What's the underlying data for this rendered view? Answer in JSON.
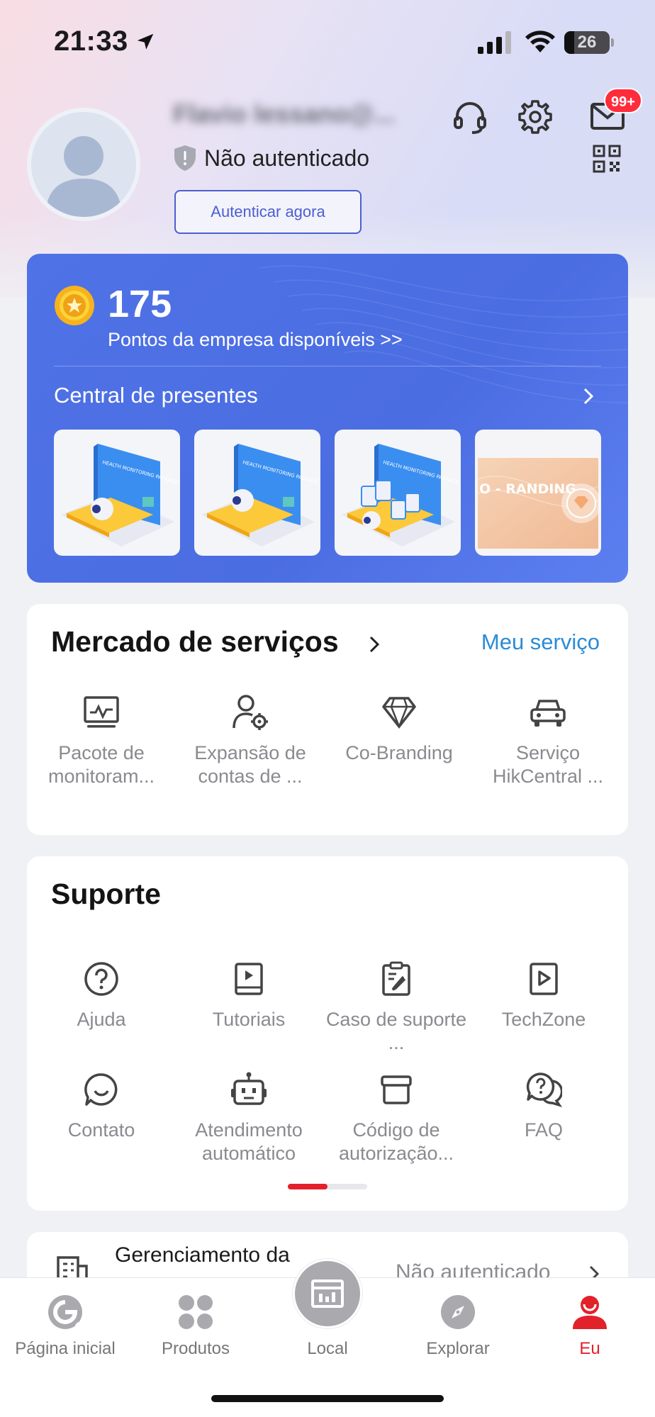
{
  "status_bar": {
    "time": "21:33",
    "battery": "26"
  },
  "profile": {
    "username": "Flavio lessano@...",
    "auth_status": "Não autenticado",
    "auth_button": "Autenticar agora",
    "notification_badge": "99+"
  },
  "points": {
    "value": "175",
    "subtitle": "Pontos da empresa disponíveis >>",
    "gift_center": "Central de presentes",
    "thumbs": [
      {
        "caption": "HEALTH MONITORING PACKAGE"
      },
      {
        "caption": "HEALTH MONITORING PACKAGE"
      },
      {
        "caption": "HEALTH MONITORING PACKAGE"
      },
      {
        "caption": "O - RANDING"
      }
    ]
  },
  "service_market": {
    "title": "Mercado de serviços",
    "my_service": "Meu serviço",
    "items": [
      {
        "label": "Pacote de monitoram...",
        "icon": "monitor-chart-icon"
      },
      {
        "label": "Expansão de contas de ...",
        "icon": "user-gear-icon"
      },
      {
        "label": "Co-Branding",
        "icon": "diamond-icon"
      },
      {
        "label": "Serviço HikCentral ...",
        "icon": "car-icon"
      }
    ]
  },
  "support": {
    "title": "Suporte",
    "items": [
      {
        "label": "Ajuda",
        "icon": "help-circle-icon"
      },
      {
        "label": "Tutoriais",
        "icon": "book-play-icon"
      },
      {
        "label": "Caso de suporte ...",
        "icon": "clipboard-wrench-icon"
      },
      {
        "label": "TechZone",
        "icon": "video-play-icon"
      },
      {
        "label": "Contato",
        "icon": "chat-bubble-icon"
      },
      {
        "label": "Atendimento automático",
        "icon": "robot-icon"
      },
      {
        "label": "Código de autorização...",
        "icon": "box-icon"
      },
      {
        "label": "FAQ",
        "icon": "faq-chat-icon"
      }
    ],
    "page_index": 1,
    "page_count": 2
  },
  "management": {
    "title": "Gerenciamento da",
    "status": "Não autenticado"
  },
  "tabbar": {
    "tabs": [
      {
        "label": "Página inicial",
        "icon": "home-logo-icon"
      },
      {
        "label": "Produtos",
        "icon": "grid-icon"
      },
      {
        "label": "Local",
        "icon": "building-icon"
      },
      {
        "label": "Explorar",
        "icon": "compass-icon"
      },
      {
        "label": "Eu",
        "icon": "user-icon"
      }
    ],
    "active": "Eu"
  },
  "colors": {
    "accent_blue": "#4b5fd1",
    "card_blue": "#4f72e6",
    "link_blue": "#2a8bd6",
    "brand_red": "#e3212b",
    "badge_red": "#ff2d3c"
  }
}
